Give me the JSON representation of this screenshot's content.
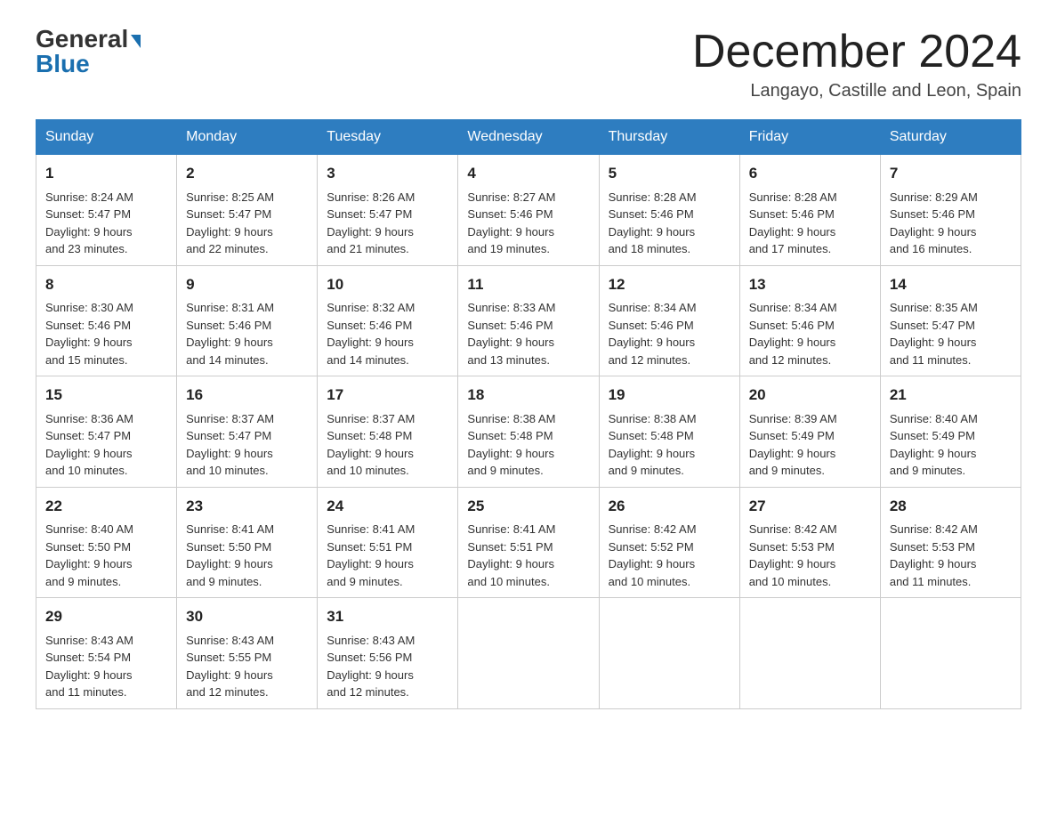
{
  "header": {
    "logo_general": "General",
    "logo_blue": "Blue",
    "month_title": "December 2024",
    "location": "Langayo, Castille and Leon, Spain"
  },
  "days_of_week": [
    "Sunday",
    "Monday",
    "Tuesday",
    "Wednesday",
    "Thursday",
    "Friday",
    "Saturday"
  ],
  "weeks": [
    [
      {
        "day": "1",
        "sunrise": "8:24 AM",
        "sunset": "5:47 PM",
        "daylight": "9 hours and 23 minutes."
      },
      {
        "day": "2",
        "sunrise": "8:25 AM",
        "sunset": "5:47 PM",
        "daylight": "9 hours and 22 minutes."
      },
      {
        "day": "3",
        "sunrise": "8:26 AM",
        "sunset": "5:47 PM",
        "daylight": "9 hours and 21 minutes."
      },
      {
        "day": "4",
        "sunrise": "8:27 AM",
        "sunset": "5:46 PM",
        "daylight": "9 hours and 19 minutes."
      },
      {
        "day": "5",
        "sunrise": "8:28 AM",
        "sunset": "5:46 PM",
        "daylight": "9 hours and 18 minutes."
      },
      {
        "day": "6",
        "sunrise": "8:28 AM",
        "sunset": "5:46 PM",
        "daylight": "9 hours and 17 minutes."
      },
      {
        "day": "7",
        "sunrise": "8:29 AM",
        "sunset": "5:46 PM",
        "daylight": "9 hours and 16 minutes."
      }
    ],
    [
      {
        "day": "8",
        "sunrise": "8:30 AM",
        "sunset": "5:46 PM",
        "daylight": "9 hours and 15 minutes."
      },
      {
        "day": "9",
        "sunrise": "8:31 AM",
        "sunset": "5:46 PM",
        "daylight": "9 hours and 14 minutes."
      },
      {
        "day": "10",
        "sunrise": "8:32 AM",
        "sunset": "5:46 PM",
        "daylight": "9 hours and 14 minutes."
      },
      {
        "day": "11",
        "sunrise": "8:33 AM",
        "sunset": "5:46 PM",
        "daylight": "9 hours and 13 minutes."
      },
      {
        "day": "12",
        "sunrise": "8:34 AM",
        "sunset": "5:46 PM",
        "daylight": "9 hours and 12 minutes."
      },
      {
        "day": "13",
        "sunrise": "8:34 AM",
        "sunset": "5:46 PM",
        "daylight": "9 hours and 12 minutes."
      },
      {
        "day": "14",
        "sunrise": "8:35 AM",
        "sunset": "5:47 PM",
        "daylight": "9 hours and 11 minutes."
      }
    ],
    [
      {
        "day": "15",
        "sunrise": "8:36 AM",
        "sunset": "5:47 PM",
        "daylight": "9 hours and 10 minutes."
      },
      {
        "day": "16",
        "sunrise": "8:37 AM",
        "sunset": "5:47 PM",
        "daylight": "9 hours and 10 minutes."
      },
      {
        "day": "17",
        "sunrise": "8:37 AM",
        "sunset": "5:48 PM",
        "daylight": "9 hours and 10 minutes."
      },
      {
        "day": "18",
        "sunrise": "8:38 AM",
        "sunset": "5:48 PM",
        "daylight": "9 hours and 9 minutes."
      },
      {
        "day": "19",
        "sunrise": "8:38 AM",
        "sunset": "5:48 PM",
        "daylight": "9 hours and 9 minutes."
      },
      {
        "day": "20",
        "sunrise": "8:39 AM",
        "sunset": "5:49 PM",
        "daylight": "9 hours and 9 minutes."
      },
      {
        "day": "21",
        "sunrise": "8:40 AM",
        "sunset": "5:49 PM",
        "daylight": "9 hours and 9 minutes."
      }
    ],
    [
      {
        "day": "22",
        "sunrise": "8:40 AM",
        "sunset": "5:50 PM",
        "daylight": "9 hours and 9 minutes."
      },
      {
        "day": "23",
        "sunrise": "8:41 AM",
        "sunset": "5:50 PM",
        "daylight": "9 hours and 9 minutes."
      },
      {
        "day": "24",
        "sunrise": "8:41 AM",
        "sunset": "5:51 PM",
        "daylight": "9 hours and 9 minutes."
      },
      {
        "day": "25",
        "sunrise": "8:41 AM",
        "sunset": "5:51 PM",
        "daylight": "9 hours and 10 minutes."
      },
      {
        "day": "26",
        "sunrise": "8:42 AM",
        "sunset": "5:52 PM",
        "daylight": "9 hours and 10 minutes."
      },
      {
        "day": "27",
        "sunrise": "8:42 AM",
        "sunset": "5:53 PM",
        "daylight": "9 hours and 10 minutes."
      },
      {
        "day": "28",
        "sunrise": "8:42 AM",
        "sunset": "5:53 PM",
        "daylight": "9 hours and 11 minutes."
      }
    ],
    [
      {
        "day": "29",
        "sunrise": "8:43 AM",
        "sunset": "5:54 PM",
        "daylight": "9 hours and 11 minutes."
      },
      {
        "day": "30",
        "sunrise": "8:43 AM",
        "sunset": "5:55 PM",
        "daylight": "9 hours and 12 minutes."
      },
      {
        "day": "31",
        "sunrise": "8:43 AM",
        "sunset": "5:56 PM",
        "daylight": "9 hours and 12 minutes."
      },
      null,
      null,
      null,
      null
    ]
  ],
  "labels": {
    "sunrise": "Sunrise:",
    "sunset": "Sunset:",
    "daylight": "Daylight:"
  }
}
